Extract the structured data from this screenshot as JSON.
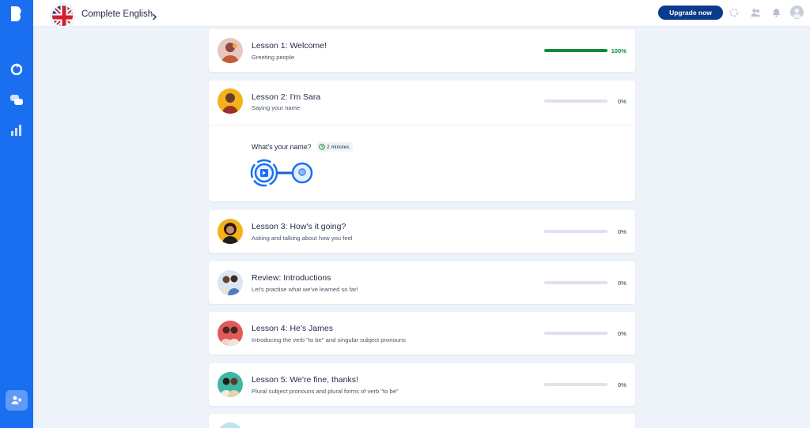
{
  "app": {
    "course_title": "Complete English",
    "upgrade_label": "Upgrade now"
  },
  "colors": {
    "sidebar": "#1a6ff0",
    "upgrade": "#0c3b8d",
    "progress_done": "#0f8a3a",
    "progress_empty": "#dde3ec"
  },
  "lessons": [
    {
      "title": "Lesson 1: Welcome!",
      "subtitle": "Greeting people",
      "progress": 1.0,
      "percent": "100%"
    },
    {
      "title": "Lesson 2: I'm Sara",
      "subtitle": "Saying your name",
      "progress": 0,
      "percent": "0%"
    },
    {
      "title": "Lesson 3: How's it going?",
      "subtitle": "Asking and talking about how you feel",
      "progress": 0,
      "percent": "0%"
    },
    {
      "title": "Review: Introductions",
      "subtitle": "Let's practise what we've learned so far!",
      "progress": 0,
      "percent": "0%"
    },
    {
      "title": "Lesson 4: He's James",
      "subtitle": "Introducing the verb \"to be\" and singular subject pronouns",
      "progress": 0,
      "percent": "0%"
    },
    {
      "title": "Lesson 5: We're fine, thanks!",
      "subtitle": "Plural subject pronouns and plural forms of verb \"to be\"",
      "progress": 0,
      "percent": "0%"
    }
  ],
  "activity": {
    "title": "What's your name?",
    "duration": "2 minutes"
  },
  "icons": {
    "sidebar": [
      "babbel-logo-icon",
      "learn-icon",
      "chat-icon",
      "stats-icon",
      "add-user-icon"
    ],
    "topbar": [
      "spinner-icon",
      "friends-icon",
      "bell-icon",
      "profile-avatar-icon"
    ]
  }
}
